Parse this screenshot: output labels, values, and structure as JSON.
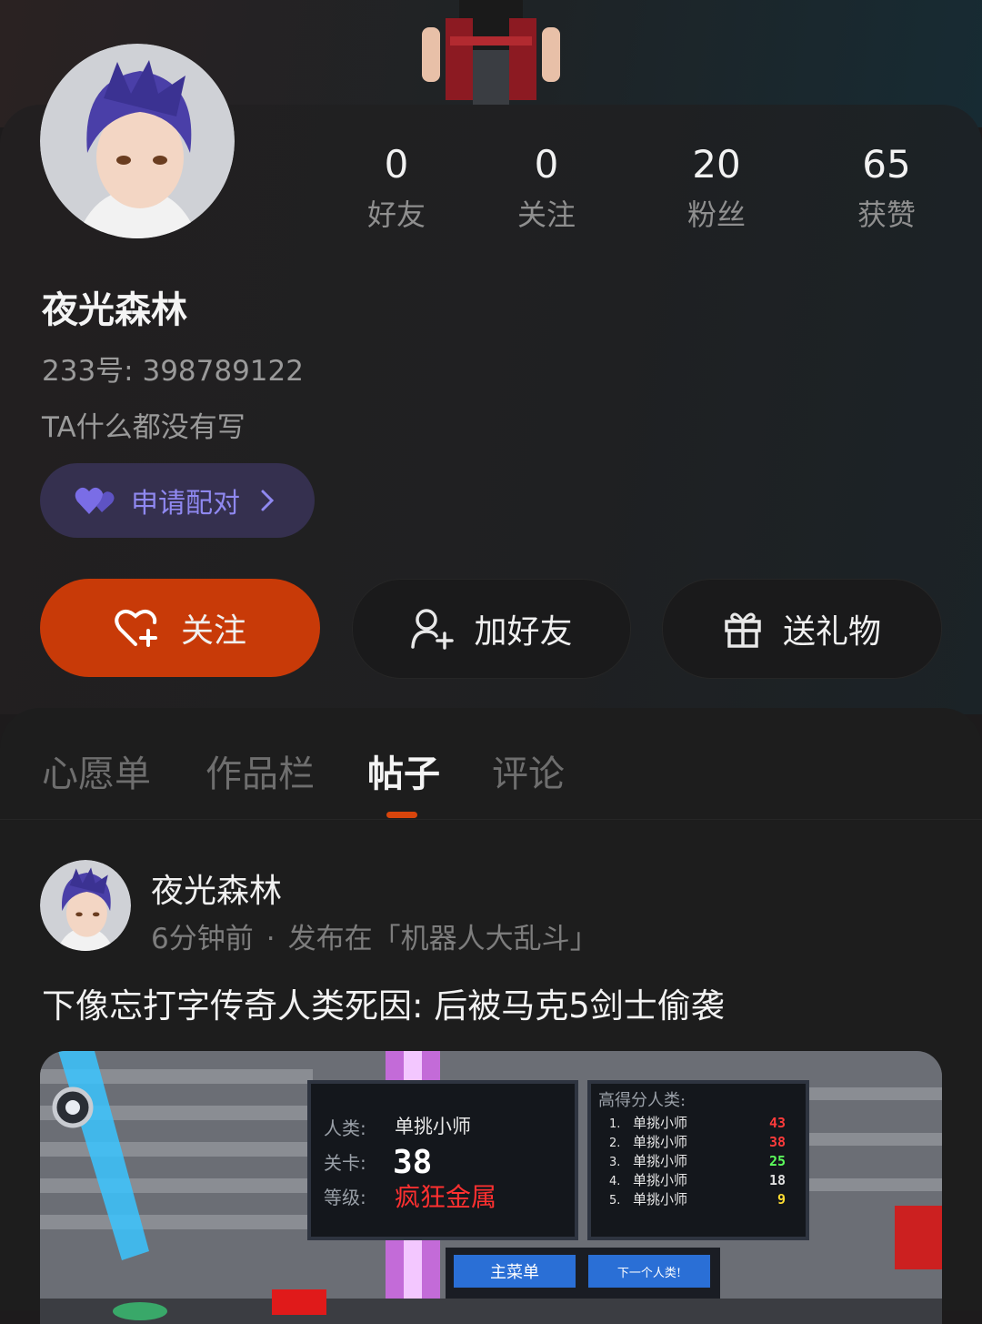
{
  "profile": {
    "name": "夜光森林",
    "uid": "233号: 398789122",
    "bio": "TA什么都没有写"
  },
  "stats": [
    {
      "value": "0",
      "label": "好友"
    },
    {
      "value": "0",
      "label": "关注"
    },
    {
      "value": "20",
      "label": "粉丝"
    },
    {
      "value": "65",
      "label": "获赞"
    }
  ],
  "pair_button": {
    "label": "申请配对"
  },
  "actions": {
    "follow": "关注",
    "add_friend": "加好友",
    "send_gift": "送礼物"
  },
  "tabs": [
    {
      "label": "心愿单",
      "active": false
    },
    {
      "label": "作品栏",
      "active": false
    },
    {
      "label": "帖子",
      "active": true
    },
    {
      "label": "评论",
      "active": false
    }
  ],
  "post": {
    "author": "夜光森林",
    "time": "6分钟前",
    "separator": "·",
    "published_in": "发布在「机器人大乱斗」",
    "title": "下像忘打字传奇人类死因: 后被马克5剑士偷袭"
  },
  "game_screenshot": {
    "human_label": "人类:",
    "human_value": "单挑小师",
    "level_label": "关卡:",
    "level_value": "38",
    "difficulty_label": "等级:",
    "difficulty_value": "疯狂金属",
    "leaderboard_title": "高得分人类:",
    "leaderboard": [
      {
        "rank": "1.",
        "name": "单挑小师",
        "score": "43",
        "color": "#ff3b3b"
      },
      {
        "rank": "2.",
        "name": "单挑小师",
        "score": "38",
        "color": "#ff3b3b"
      },
      {
        "rank": "3.",
        "name": "单挑小师",
        "score": "25",
        "color": "#5cff5c"
      },
      {
        "rank": "4.",
        "name": "单挑小师",
        "score": "18",
        "color": "#e0e0e0"
      },
      {
        "rank": "5.",
        "name": "单挑小师",
        "score": "9",
        "color": "#ffdd33"
      }
    ],
    "main_menu": "主菜单",
    "next_human": "下一个人类!"
  },
  "colors": {
    "accent": "#c83a08",
    "tab_indicator": "#d8450c",
    "pair_bg": "#35304f",
    "pair_text": "#8f88f0"
  }
}
